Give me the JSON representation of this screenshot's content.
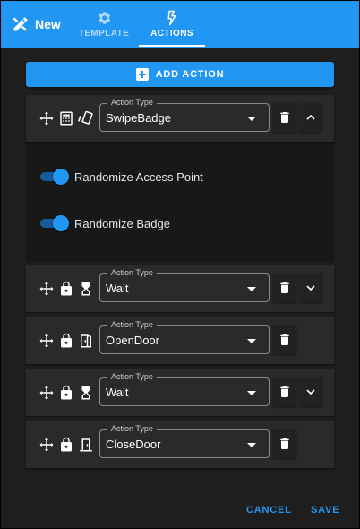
{
  "header": {
    "brand_label": "New",
    "tabs": [
      {
        "label": "TEMPLATE",
        "icon": "gear-icon"
      },
      {
        "label": "ACTIONS",
        "icon": "lightning-icon"
      }
    ],
    "active_tab": "ACTIONS"
  },
  "main": {
    "add_action_label": "ADD ACTION",
    "field_label": "Action Type",
    "actions": [
      {
        "value": "SwipeBadge",
        "expanded": true
      },
      {
        "value": "Wait",
        "expanded": false
      },
      {
        "value": "OpenDoor",
        "expanded": false
      },
      {
        "value": "Wait",
        "expanded": false
      },
      {
        "value": "CloseDoor",
        "expanded": false
      }
    ],
    "options": [
      {
        "label": "Randomize Access Point",
        "on": true
      },
      {
        "label": "Randomize Badge",
        "on": true
      }
    ]
  },
  "footer": {
    "cancel_label": "CANCEL",
    "save_label": "SAVE"
  },
  "colors": {
    "accent": "#2196f3",
    "surface": "#2a2a2a",
    "background": "#1e1e1e"
  }
}
